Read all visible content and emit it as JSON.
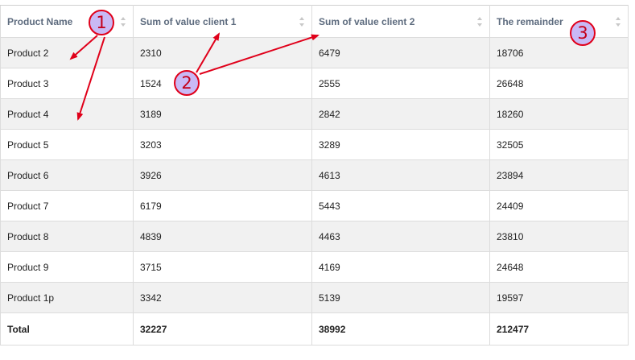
{
  "table": {
    "headers": [
      "Product Name",
      "Sum of value client 1",
      "Sum of value client 2",
      "The remainder"
    ],
    "rows": [
      [
        "Product 2",
        "2310",
        "6479",
        "18706"
      ],
      [
        "Product 3",
        "1524",
        "2555",
        "26648"
      ],
      [
        "Product 4",
        "3189",
        "2842",
        "18260"
      ],
      [
        "Product 5",
        "3203",
        "3289",
        "32505"
      ],
      [
        "Product 6",
        "3926",
        "4613",
        "23894"
      ],
      [
        "Product 7",
        "6179",
        "5443",
        "24409"
      ],
      [
        "Product 8",
        "4839",
        "4463",
        "23810"
      ],
      [
        "Product 9",
        "3715",
        "4169",
        "24648"
      ],
      [
        "Product 1p",
        "3342",
        "5139",
        "19597"
      ]
    ],
    "footer": [
      "Total",
      "32227",
      "38992",
      "212477"
    ]
  },
  "annotations": {
    "badge_1": "1",
    "badge_2": "2",
    "badge_3": "3",
    "arrow_color": "#e0001a",
    "badge_fill": "#c9b9f5"
  },
  "icons": {
    "sort": "sort-icon"
  }
}
